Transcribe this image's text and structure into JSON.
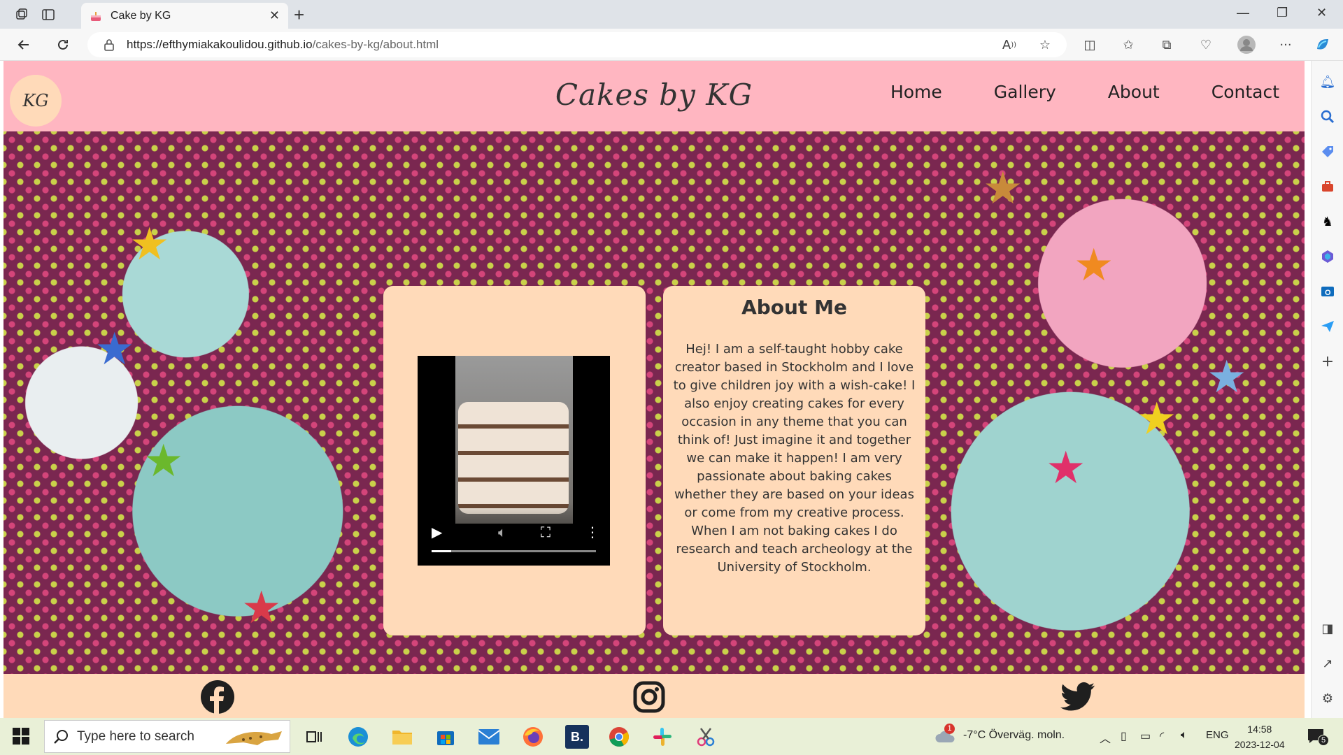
{
  "browser": {
    "tab_title": "Cake by KG",
    "url_host": "https://efthymiakakoulidou.github.io",
    "url_path": "/cakes-by-kg/about.html"
  },
  "site": {
    "logo_text": "KG",
    "brand": "Cakes by KG",
    "nav": [
      "Home",
      "Gallery",
      "About",
      "Contact"
    ],
    "about_title": "About Me",
    "about_text": "Hej! I am a self-taught hobby cake creator based in Stockholm and I love to give children joy with a wish-cake! I also enjoy creating cakes for every occasion in any theme that you can think of! Just imagine it and together we can make it happen! I am very passionate about baking cakes whether they are based on your ideas or come from my creative process. When I am not baking cakes I do research and teach archeology at the University of Stockholm.",
    "video_progress": 0.12,
    "footer_icons": [
      "facebook-icon",
      "instagram-icon",
      "twitter-icon"
    ]
  },
  "taskbar": {
    "search_placeholder": "Type here to search",
    "weather_badge": "1",
    "weather": "-7°C  Överväg. moln.",
    "lang": "ENG",
    "time": "14:58",
    "date": "2023-12-04",
    "notification_count": "5"
  },
  "colors": {
    "header_pink": "#ffb6c1",
    "card_peach": "#ffdab9"
  }
}
